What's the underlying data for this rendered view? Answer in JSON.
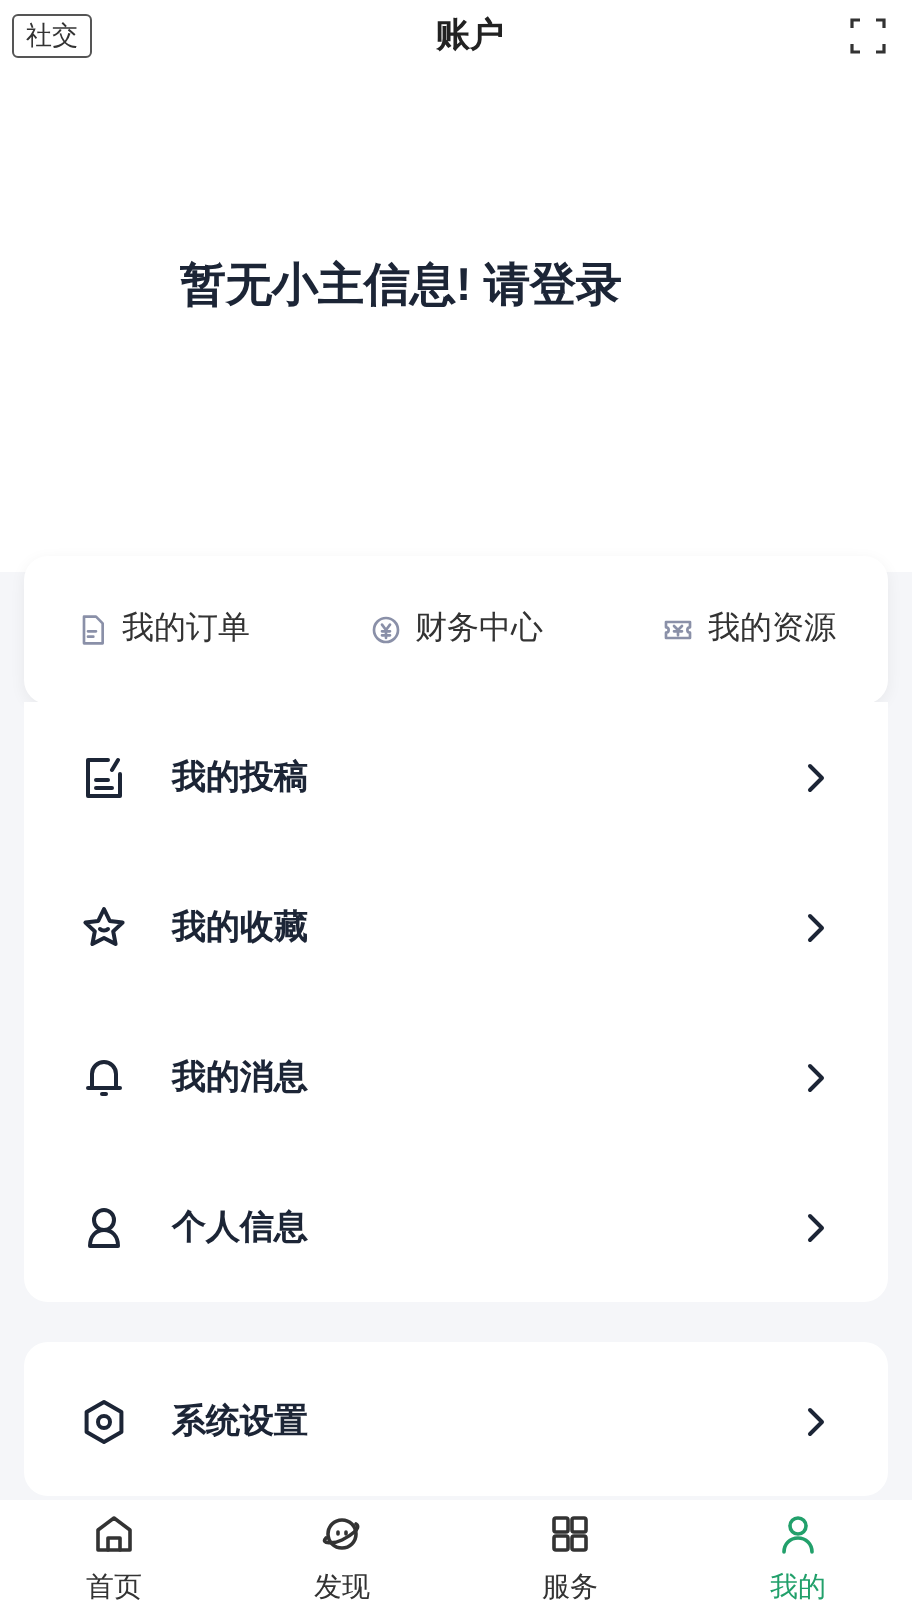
{
  "header": {
    "left_button": "社交",
    "title": "账户"
  },
  "login_prompt": "暂无小主信息! 请登录",
  "quick_links": [
    {
      "label": "我的订单",
      "kind": "order"
    },
    {
      "label": "财务中心",
      "kind": "finance"
    },
    {
      "label": "我的资源",
      "kind": "resource"
    }
  ],
  "menu": [
    {
      "label": "我的投稿",
      "kind": "edit"
    },
    {
      "label": "我的收藏",
      "kind": "star"
    },
    {
      "label": "我的消息",
      "kind": "bell"
    },
    {
      "label": "个人信息",
      "kind": "user"
    }
  ],
  "settings_menu": [
    {
      "label": "系统设置",
      "kind": "settings"
    }
  ],
  "tab_bar": [
    {
      "label": "首页",
      "kind": "home",
      "selected": false
    },
    {
      "label": "发现",
      "kind": "discover",
      "selected": false
    },
    {
      "label": "服务",
      "kind": "service",
      "selected": false
    },
    {
      "label": "我的",
      "kind": "me",
      "selected": true
    }
  ]
}
